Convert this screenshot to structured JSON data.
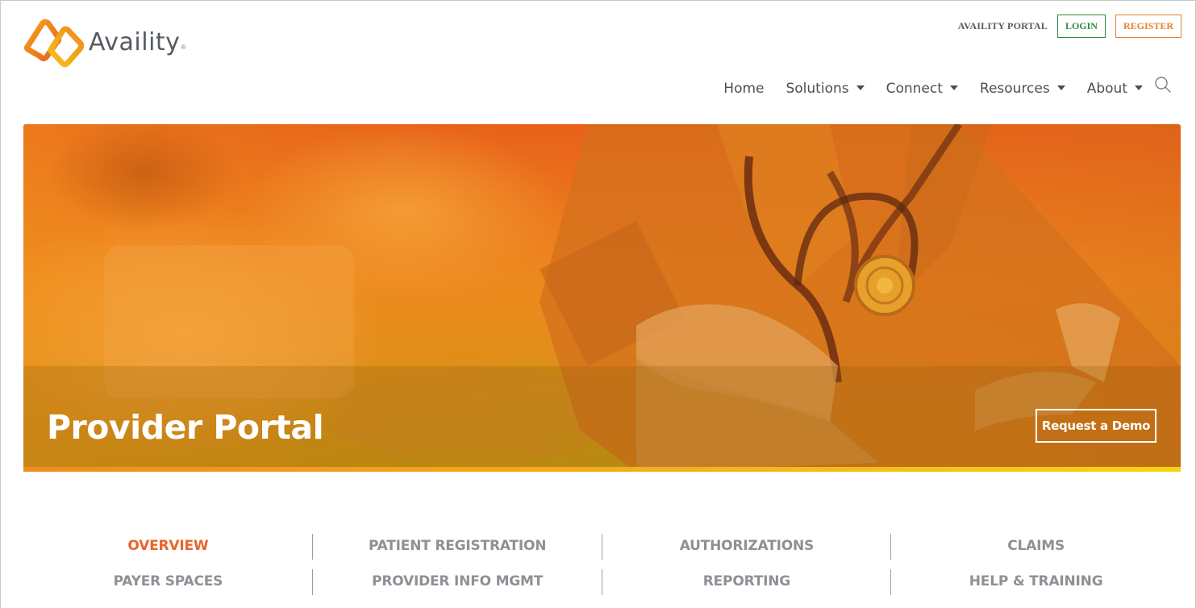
{
  "header": {
    "brand": "Availity",
    "utility": {
      "portal_link": "AVAILITY PORTAL",
      "login_label": "LOGIN",
      "register_label": "REGISTER"
    },
    "nav": [
      {
        "label": "Home",
        "has_dropdown": false
      },
      {
        "label": "Solutions",
        "has_dropdown": true
      },
      {
        "label": "Connect",
        "has_dropdown": true
      },
      {
        "label": "Resources",
        "has_dropdown": true
      },
      {
        "label": "About",
        "has_dropdown": true
      }
    ],
    "search_icon": "search-icon"
  },
  "hero": {
    "title": "Provider Portal",
    "cta_label": "Request a Demo",
    "overlay_color": "#e8822a",
    "bottom_bar_colors": [
      "#ef8d1c",
      "#f6d413"
    ]
  },
  "tabs": {
    "row1": [
      "OVERVIEW",
      "PATIENT REGISTRATION",
      "AUTHORIZATIONS",
      "CLAIMS"
    ],
    "row2": [
      "PAYER SPACES",
      "PROVIDER INFO MGMT",
      "REPORTING",
      "HELP & TRAINING"
    ],
    "active": "OVERVIEW",
    "active_color": "#e8652c",
    "inactive_color": "#8d9196"
  },
  "colors": {
    "login_green": "#2e8b3e",
    "register_orange": "#e8812a",
    "text_gray": "#4a4f55"
  }
}
